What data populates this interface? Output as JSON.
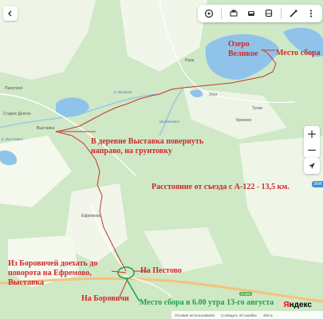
{
  "colors": {
    "forest": "#cfe8c6",
    "clearing": "#f4f7ee",
    "water": "#8fc3ea",
    "route": "#c0392b",
    "annotation_red": "#cc2a2a",
    "annotation_green": "#1aa34a",
    "road": "#f3c47a"
  },
  "toolbar": {
    "icons": [
      "layers-icon",
      "print-icon",
      "car-icon",
      "bus-icon",
      "ruler-icon",
      "more-icon"
    ]
  },
  "places": {
    "palutino": "Палутино",
    "staroe_dolgoe": "Старое Долгое",
    "vystavka": "Выставка",
    "efremovo": "Ефремово",
    "rakhi": "Рахи",
    "ugol": "Угол",
    "tuhan": "Тухан",
    "krenovo": "Кренево",
    "ozero": "Озеро",
    "velikoe": "Великое"
  },
  "rivers": {
    "r1": "р. Великая",
    "r2": "р. Выставка",
    "r3": "Шибатовка"
  },
  "annotations": {
    "meeting_place_top": "Место сбора",
    "vystavka_turn": "В деревне Выставка повернуть направо, на грунтовку",
    "distance": "Расстояние от съезда с А-122 - 13,5 км.",
    "from_borovichi": "Из Боровичей доехать до поворота на Ефремово, Выставка",
    "to_pestovo": "На Пестово",
    "to_borovichi": "На Боровичи",
    "meeting_place_bottom": "Место сбора в 6.00 утра 13-го августа"
  },
  "road_sign": "А-122",
  "traffic_badge": "2КМ",
  "footer": {
    "condition": "Условия использования",
    "errors": "Сообщить об ошибке",
    "scale": "400 м"
  },
  "logo": {
    "first": "Я",
    "rest": "ндекс"
  }
}
